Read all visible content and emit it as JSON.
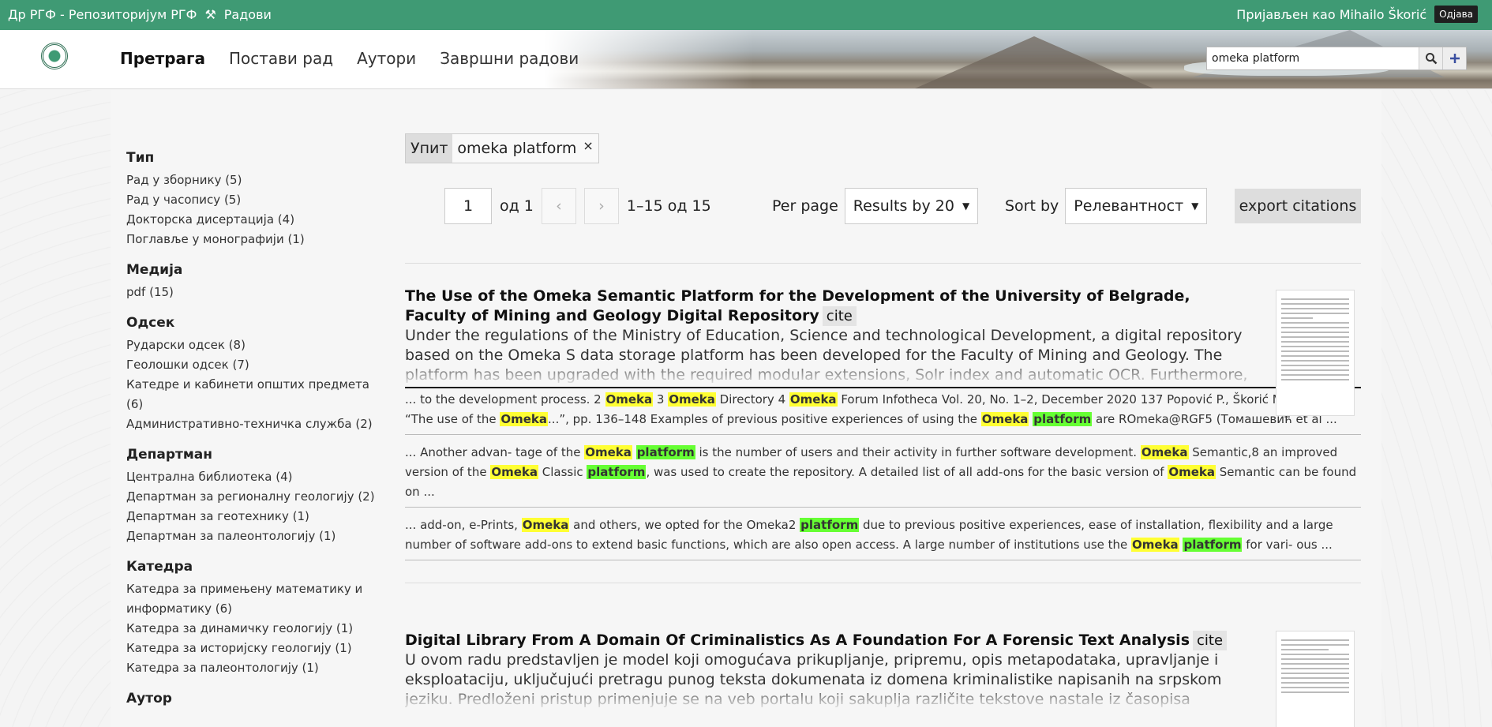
{
  "topbar": {
    "site_title": "Др РГФ - Репозиторијум РГФ",
    "tools_icon": "hammer-pick-icon",
    "works_link": "Радови",
    "logged_in": "Пријављен као Mihailo Škorić",
    "logout": "Одјава"
  },
  "nav": {
    "items": [
      {
        "label": "Претрага",
        "active": true
      },
      {
        "label": "Постави рад",
        "active": false
      },
      {
        "label": "Аутори",
        "active": false
      },
      {
        "label": "Завршни радови",
        "active": false
      }
    ]
  },
  "search": {
    "value": "omeka platform",
    "search_icon": "search-icon",
    "add_icon": "plus-icon"
  },
  "facets": [
    {
      "title": "Тип",
      "items": [
        "Рад у зборнику (5)",
        "Рад у часопису (5)",
        "Докторска дисертација (4)",
        "Поглавље у монографији (1)"
      ]
    },
    {
      "title": "Медија",
      "items": [
        "pdf (15)"
      ]
    },
    {
      "title": "Одсек",
      "items": [
        "Рударски одсек (8)",
        "Геолошки одсек (7)",
        "Катедре и кабинети општих предмета (6)",
        "Административно-техничка служба (2)"
      ]
    },
    {
      "title": "Департман",
      "items": [
        "Централна библиотека (4)",
        "Департман за регионалну геологију (2)",
        "Департман за геотехнику (1)",
        "Департман за палеонтологију (1)"
      ]
    },
    {
      "title": "Катедра",
      "items": [
        "Катедра за примењену математику и информатику (6)",
        "Катедра за динамичку геологију (1)",
        "Катедра за историјску геологију (1)",
        "Катедра за палеонтологију (1)"
      ]
    },
    {
      "title": "Аутор",
      "items": []
    }
  ],
  "query": {
    "label": "Упит",
    "value": "omeka platform",
    "remove": "×"
  },
  "pager": {
    "page": "1",
    "of": "од 1",
    "prev": "‹",
    "next": "›",
    "range": "1–15 од 15"
  },
  "perpage": {
    "label": "Per page",
    "value": "Results by 20"
  },
  "sortby": {
    "label": "Sort by",
    "value": "Релевантност"
  },
  "export": "export citations",
  "results": [
    {
      "title": "The Use of the Omeka Semantic Platform for the Development of the University of Belgrade, Faculty of Mining and Geology Digital Repository",
      "cite": "cite",
      "abstract": "Under the regulations of the Ministry of Education, Science and technological Development, a digital repository based on the Omeka S data storage platform has been developed for the Faculty of Mining and Geology. The platform has been upgraded with the required modular extensions, Solr index and automatic OCR. Furthermore, document indexing and search have been fine-tuned with the aid of",
      "snippets": [
        "... to the development process. 2 [y:Omeka] 3 [y:Omeka] Directory 4 [y:Omeka] Forum Infotheca Vol. 20, No. 1–2, December 2020 137 Popović P., Škorić M., Rujević B. “The use of the [y:Omeka]...”, pp. 136–148 Examples of previous positive experiences of using the [y:Omeka] [g:platform] are ROmeka@RGF5 (Томашевић et al ...",
        "... Another advan- tage of the [y:Omeka] [g:platform] is the number of users and their activity in further software development. [y:Omeka] Semantic,8 an improved version of the [y:Omeka] Classic [g:platform], was used to create the repository. A detailed list of all add-ons for the basic version of [y:Omeka] Semantic can be found on ...",
        "... add-on, e-Prints, [y:Omeka] and others, we opted for the Omeka2 [g:platform] due to previous positive experiences, ease of installation, flexibility and a large number of software add-ons to extend basic functions, which are also open access. A large number of institutions use the [y:Omeka] [g:platform] for vari- ous ..."
      ]
    },
    {
      "title": "Digital Library From A Domain Of Criminalistics As A Foundation For A Forensic Text Analysis",
      "cite": "cite",
      "abstract": "U ovom radu predstavljen je model koji omogućava prikupljanje, pripremu, opis metapodataka, upravljanje i eksploataciju, uključujući pretragu punog teksta dokumenata iz domena kriminalistike napisanih na srpskom jeziku. Predloženi pristup primenjuje se na veb portalu koji sakuplja različite tekstove nastale iz časopisa Akademije za kriminalistiku i policijske studije, Krivičnog zakona Srbije, konferencija \"Tara\" i \"Beisa\", kao i iz nekih doktorskih",
      "snippets": []
    }
  ]
}
